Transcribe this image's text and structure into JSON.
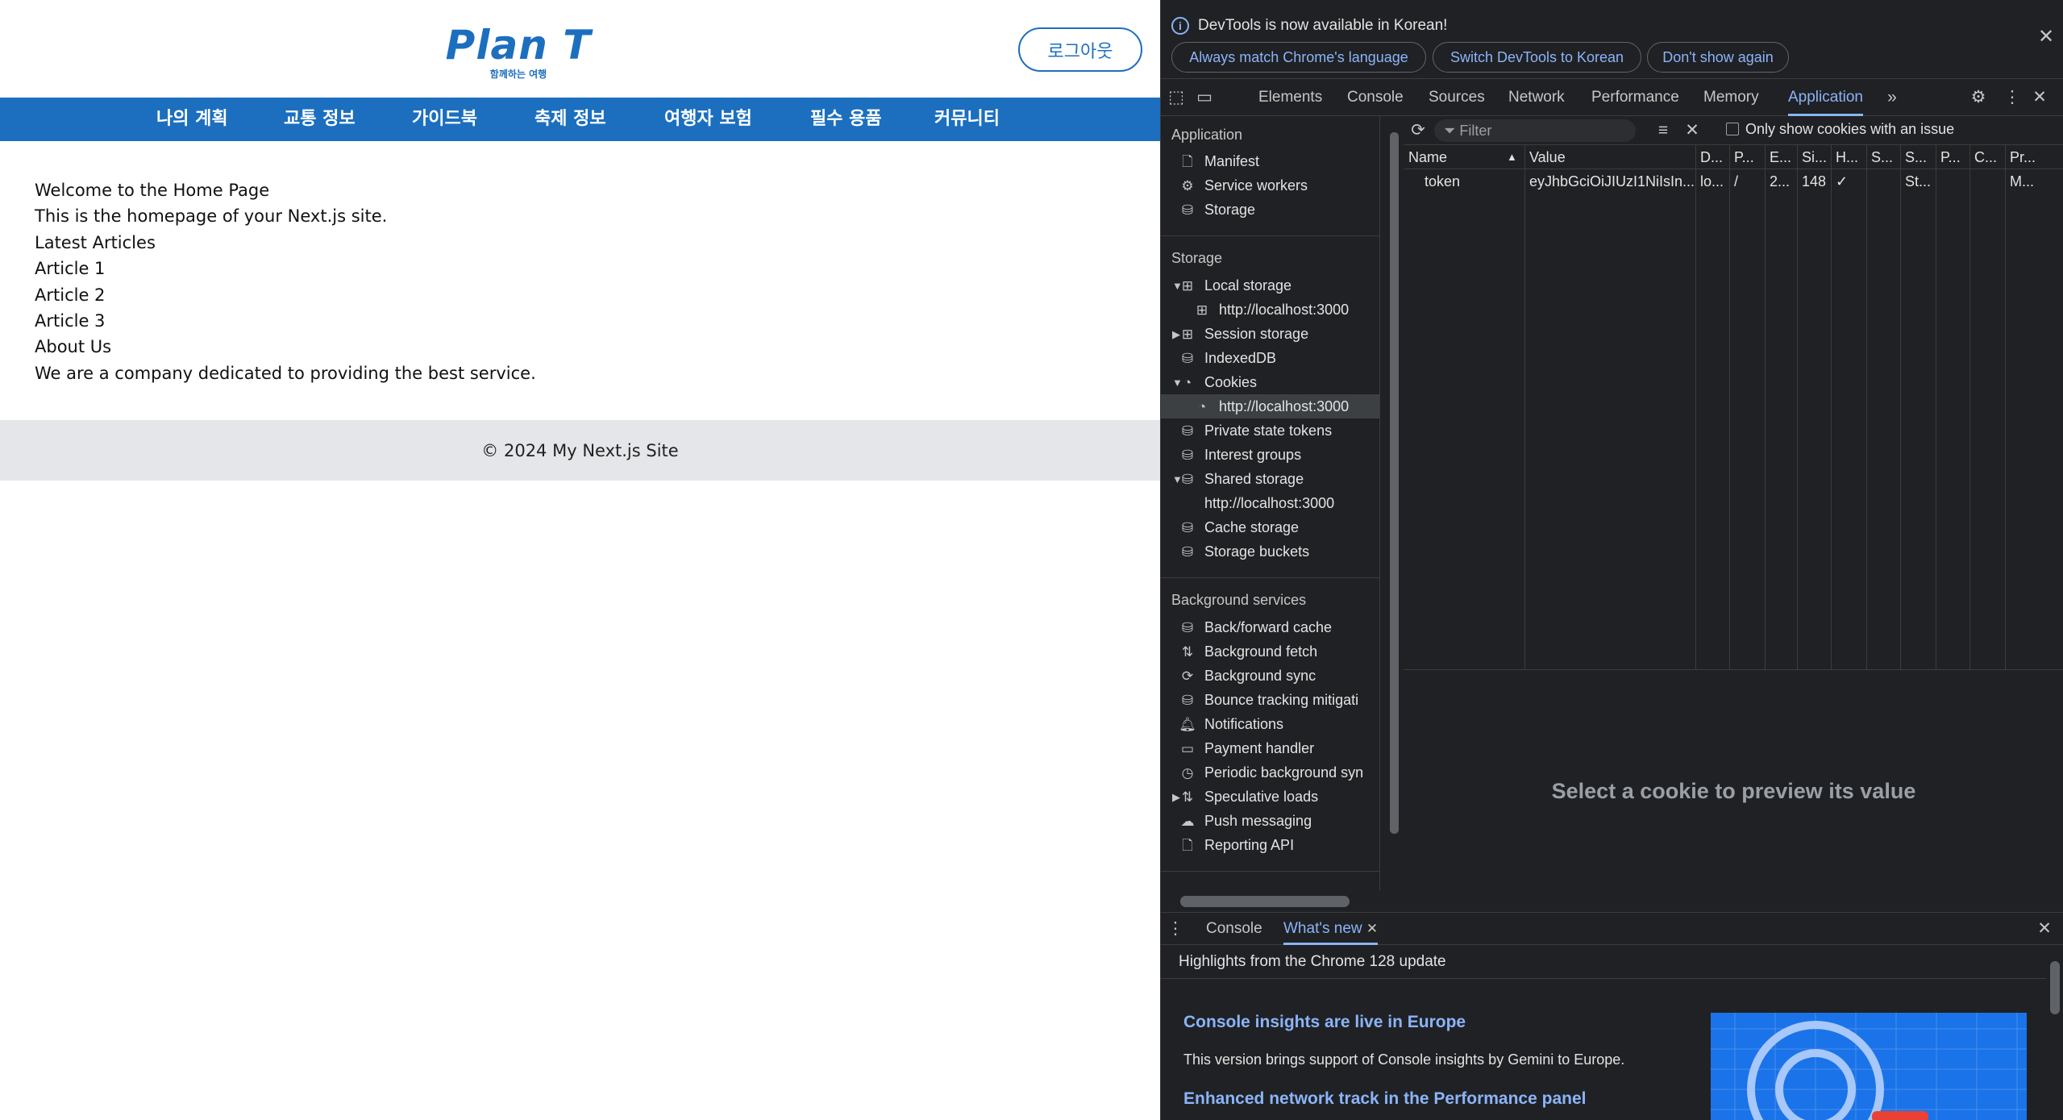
{
  "site": {
    "logo": {
      "main": "Plan T",
      "sub": "함께하는 여행"
    },
    "logout_label": "로그아웃",
    "nav": [
      "나의 계획",
      "교통 정보",
      "가이드북",
      "축제 정보",
      "여행자 보험",
      "필수 용품",
      "커뮤니티"
    ],
    "main": {
      "welcome": "Welcome to the Home Page",
      "intro": "This is the homepage of your Next.js site.",
      "latest_heading": "Latest Articles",
      "articles": [
        "Article 1",
        "Article 2",
        "Article 3"
      ],
      "about_heading": "About Us",
      "about_text": "We are a company dedicated to providing the best service."
    },
    "footer": "© 2024 My Next.js Site",
    "colors": {
      "brand": "#1c6fbf",
      "footer_bg": "#e5e6e9"
    }
  },
  "devtools": {
    "infobar": {
      "message": "DevTools is now available in Korean!",
      "buttons": [
        "Always match Chrome's language",
        "Switch DevTools to Korean",
        "Don't show again"
      ]
    },
    "tabs": [
      "Elements",
      "Console",
      "Sources",
      "Network",
      "Performance",
      "Memory",
      "Application"
    ],
    "active_tab": "Application",
    "sidebar": {
      "application_title": "Application",
      "application_items": [
        "Manifest",
        "Service workers",
        "Storage"
      ],
      "storage_title": "Storage",
      "storage_items": {
        "local_storage": "Local storage",
        "local_origin": "http://localhost:3000",
        "session_storage": "Session storage",
        "indexeddb": "IndexedDB",
        "cookies": "Cookies",
        "cookie_origin": "http://localhost:3000",
        "private_state": "Private state tokens",
        "interest_groups": "Interest groups",
        "shared_storage": "Shared storage",
        "shared_origin": "http://localhost:3000",
        "cache_storage": "Cache storage",
        "storage_buckets": "Storage buckets"
      },
      "background_title": "Background services",
      "background_items": [
        "Back/forward cache",
        "Background fetch",
        "Background sync",
        "Bounce tracking mitigati",
        "Notifications",
        "Payment handler",
        "Periodic background syn",
        "Speculative loads",
        "Push messaging",
        "Reporting API"
      ]
    },
    "cookies": {
      "filter_placeholder": "Filter",
      "only_issue_label": "Only show cookies with an issue",
      "columns": [
        "Name",
        "Value",
        "D...",
        "P...",
        "E...",
        "Si...",
        "H...",
        "S...",
        "S...",
        "P...",
        "C...",
        "Pr..."
      ],
      "rows": [
        [
          "token",
          "eyJhbGciOiJIUzI1NiIsIn...",
          "lo...",
          "/",
          "2...",
          "148",
          "✓",
          "",
          "St...",
          "",
          "",
          "M..."
        ]
      ],
      "preview_placeholder": "Select a cookie to preview its value"
    },
    "drawer": {
      "tabs": [
        "Console",
        "What's new"
      ],
      "active_tab": "What's new",
      "highlights": "Highlights from the Chrome 128 update",
      "features": [
        {
          "title": "Console insights are live in Europe",
          "desc": "This version brings support of Console insights by Gemini to Europe."
        },
        {
          "title": "Enhanced network track in the Performance panel",
          "desc": ""
        }
      ]
    },
    "colors": {
      "accent": "#8ab4f8",
      "bg": "#202124"
    }
  }
}
